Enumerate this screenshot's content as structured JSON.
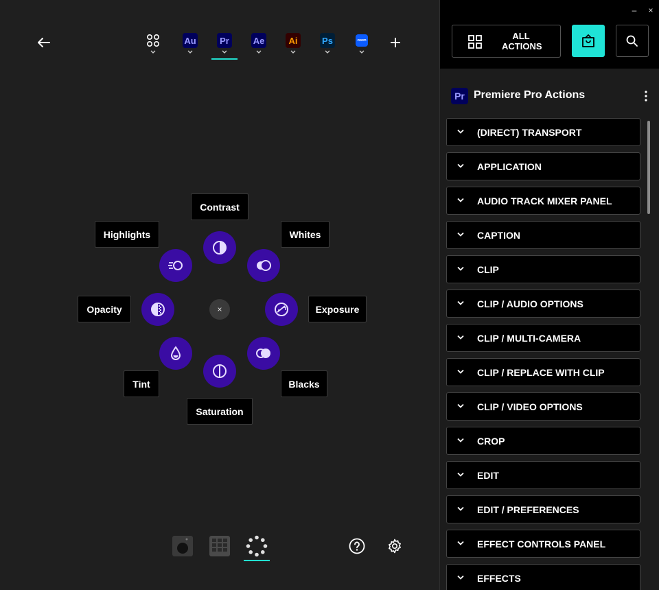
{
  "header": {
    "app_tabs": [
      {
        "id": "all-apps",
        "label": "",
        "icon": "grid-icon"
      },
      {
        "id": "au",
        "label": "Au",
        "bg": "#00005b",
        "fg": "#9999ff"
      },
      {
        "id": "pr",
        "label": "Pr",
        "bg": "#00005b",
        "fg": "#9999ff",
        "active": true
      },
      {
        "id": "ae",
        "label": "Ae",
        "bg": "#00005b",
        "fg": "#9999ff"
      },
      {
        "id": "ai",
        "label": "Ai",
        "bg": "#330000",
        "fg": "#ff9a00"
      },
      {
        "id": "ps",
        "label": "Ps",
        "bg": "#001e36",
        "fg": "#31a8ff"
      },
      {
        "id": "zoom",
        "label": "zoom",
        "bg": "#0b5cff",
        "fg": "#ffffff"
      }
    ]
  },
  "radial": {
    "center": "×",
    "labels": {
      "contrast": "Contrast",
      "whites": "Whites",
      "exposure": "Exposure",
      "blacks": "Blacks",
      "saturation": "Saturation",
      "tint": "Tint",
      "opacity": "Opacity",
      "highlights": "Highlights"
    }
  },
  "window": {
    "minimize": "–",
    "close": "×"
  },
  "right_panel": {
    "all_actions_label": "ALL ACTIONS",
    "badge": "Pr",
    "title": "Premiere Pro Actions",
    "actions": [
      "(DIRECT) TRANSPORT",
      "APPLICATION",
      "AUDIO TRACK MIXER PANEL",
      "CAPTION",
      "CLIP",
      "CLIP / AUDIO OPTIONS",
      "CLIP / MULTI-CAMERA",
      "CLIP / REPLACE WITH CLIP",
      "CLIP / VIDEO OPTIONS",
      "CROP",
      "EDIT",
      "EDIT / PREFERENCES",
      "EFFECT CONTROLS PANEL",
      "EFFECTS"
    ]
  },
  "colors": {
    "accent": "#1fe3d6",
    "radial_button": "#3a0ca3",
    "icon_fill": "#e6dcff"
  }
}
